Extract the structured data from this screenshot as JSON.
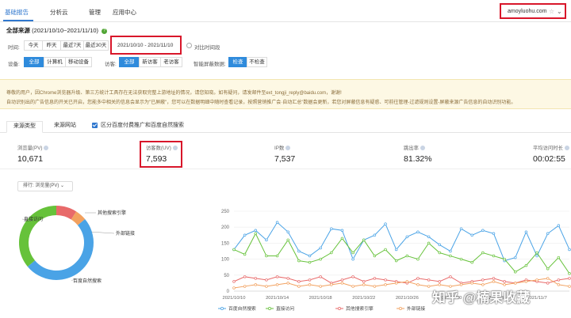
{
  "nav": {
    "items": [
      "基础报告",
      "分析云",
      "管理",
      "应用中心"
    ],
    "domain": "amoyluohu.com"
  },
  "section": {
    "title": "全部来源",
    "range": "(2021/10/10~2021/11/10)"
  },
  "time_filter": {
    "label": "时间:",
    "options": [
      "今天",
      "昨天",
      "最近7天",
      "最近30天"
    ],
    "date_range": "2021/10/10 - 2021/11/10",
    "compare_label": "对比时间段"
  },
  "device_filter": {
    "label": "设备:",
    "options": [
      "全部",
      "计算机",
      "移动设备"
    ]
  },
  "visitor_filter": {
    "label": "访客:",
    "options": [
      "全部",
      "新访客",
      "老访客"
    ]
  },
  "smart_filter": {
    "label": "智能屏蔽数据:",
    "options": [
      "检查",
      "不检查"
    ]
  },
  "notice": {
    "line1": "尊敬的用户，因Chrome浏览器升级、第三方统计工具存在无法获取完整上游地址的情况，请您知晓。如有疑问，请发邮件至ext_tongji_reply@baidu.com，谢谢!",
    "line2": "自动识别出的广告信息的开关已开启，您能多中相关的信息会显示为\"已屏蔽\"，您可以在数据明细中随时查看记录，按照营销推广会·自动汇总\"数据会更新，若您对屏蔽信息有疑惑、可前往管理-过滤规则设置-屏蔽来源广告信息的自动识别功能。"
  },
  "tabs": {
    "items": [
      "来源类型",
      "来源网站"
    ],
    "checkbox_label": "区分百度付费推广和百度自然搜索"
  },
  "metrics": [
    {
      "label": "浏览量(PV)",
      "value": "10,671"
    },
    {
      "label": "访客数(UV)",
      "value": "7,593"
    },
    {
      "label": "IP数",
      "value": "7,537"
    },
    {
      "label": "跳出率",
      "value": "81.32%"
    },
    {
      "label": "平均访问时长",
      "value": "00:02:55"
    }
  ],
  "sort": {
    "label": "排行:",
    "value": "浏览量(PV)"
  },
  "colors": {
    "blue": "#4aa3e6",
    "green": "#66c23a",
    "red": "#e86a6a",
    "orange": "#f2a15f",
    "accent": "#2f77ce",
    "highlight": "#d8162a"
  },
  "watermark": "知乎 @楠果收藏",
  "chart_data": [
    {
      "type": "pie",
      "labels": [
        "其他搜索引擎",
        "外部链接",
        "百度自然搜索",
        "直接访问"
      ],
      "values": [
        9,
        5,
        50,
        36
      ],
      "colors": [
        "#e86a6a",
        "#f2a15f",
        "#4aa3e6",
        "#66c23a"
      ]
    },
    {
      "type": "line",
      "ylim": [
        0,
        250
      ],
      "yticks": [
        0,
        50,
        100,
        150,
        200,
        250
      ],
      "x_ticks": [
        "2021/10/10",
        "2021/10/14",
        "2021/10/18",
        "2021/10/22",
        "2021/10/26",
        "2021/10/30",
        "2021/11/3",
        "2021/11/7"
      ],
      "x_count": 32,
      "series": [
        {
          "name": "百度自然搜索",
          "color": "#4aa3e6",
          "values": [
            130,
            175,
            190,
            160,
            215,
            185,
            125,
            110,
            135,
            195,
            190,
            100,
            160,
            175,
            210,
            130,
            170,
            185,
            170,
            145,
            125,
            195,
            175,
            190,
            180,
            95,
            105,
            185,
            110,
            180,
            205,
            130
          ]
        },
        {
          "name": "直接访问",
          "color": "#66c23a",
          "values": [
            130,
            115,
            180,
            110,
            110,
            160,
            95,
            90,
            100,
            120,
            165,
            120,
            160,
            110,
            130,
            95,
            110,
            100,
            150,
            120,
            110,
            100,
            90,
            120,
            110,
            100,
            60,
            80,
            120,
            70,
            105,
            55
          ]
        },
        {
          "name": "其他搜索引擎",
          "color": "#e86a6a",
          "values": [
            30,
            45,
            40,
            35,
            45,
            40,
            30,
            35,
            45,
            25,
            35,
            45,
            30,
            40,
            35,
            30,
            25,
            40,
            35,
            30,
            45,
            25,
            30,
            35,
            40,
            30,
            25,
            35,
            30,
            25,
            35,
            40
          ]
        },
        {
          "name": "外部链接",
          "color": "#f2a15f",
          "values": [
            10,
            15,
            20,
            15,
            20,
            25,
            15,
            20,
            15,
            20,
            25,
            15,
            20,
            15,
            20,
            25,
            30,
            20,
            15,
            20,
            15,
            20,
            25,
            20,
            30,
            20,
            25,
            30,
            35,
            40,
            20,
            15
          ]
        }
      ]
    }
  ]
}
